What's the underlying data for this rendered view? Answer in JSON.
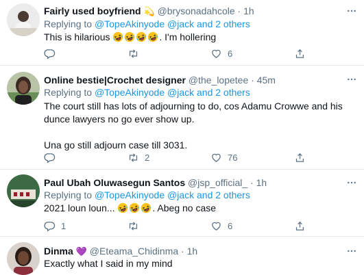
{
  "tweets": [
    {
      "name": "Fairly used boyfriend",
      "name_emoji": "💫",
      "handle": "@brysonadahcole",
      "time": "1h",
      "replying_prefix": "Replying to ",
      "mention1": "@TopeAkinyode",
      "mention_sep": " ",
      "mention2": "@jack",
      "mention_and": " and ",
      "mention_others": "2 others",
      "text_before": "This is hilarious ",
      "text_after": ". I'm hollering",
      "replies": "",
      "retweets": "",
      "likes": "6"
    },
    {
      "name": "Online bestie|Crochet designer",
      "handle": "@the_lopetee",
      "time": "45m",
      "replying_prefix": "Replying to ",
      "mention1": "@TopeAkinyode",
      "mention_sep": " ",
      "mention2": "@jack",
      "mention_and": " and ",
      "mention_others": "2 others",
      "text_line1": "The court still has lots of adjourning to do, cos Adamu Crowwe and his",
      "text_line2": "dunce lawyers no go ever show up.",
      "text_line3": "Una go still adjourn case till 3031.",
      "replies": "",
      "retweets": "2",
      "likes": "76"
    },
    {
      "name": "Paul Ubah Oluwasegun Santos",
      "handle": "@jsp_official_",
      "time": "1h",
      "replying_prefix": "Replying to ",
      "mention1": "@TopeAkinyode",
      "mention_sep": " ",
      "mention2": "@jack",
      "mention_and": " and ",
      "mention_others": "2 others",
      "text_before": "2021 loun loun... ",
      "text_after": ". Abeg no case",
      "replies": "1",
      "retweets": "",
      "likes": "6"
    },
    {
      "name": "Dinma",
      "name_emoji": "💜",
      "handle": "@Eteama_Chidinma",
      "time": "1h",
      "text": "Exactly what I said in my mind"
    }
  ],
  "separator": "·",
  "colors": {
    "mention": "#1b95e0",
    "secondary": "#5b7083",
    "border": "#e1e8ed"
  },
  "icons": [
    "reply-icon",
    "retweet-icon",
    "like-icon",
    "share-icon",
    "more-icon",
    "laughing-emoji-icon"
  ]
}
